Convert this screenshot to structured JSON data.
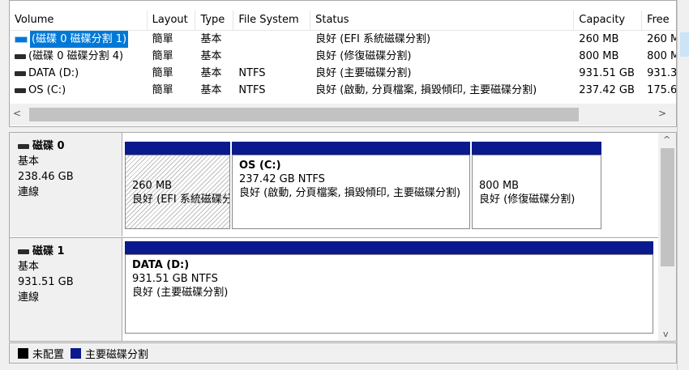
{
  "list": {
    "columns": [
      "Volume",
      "Layout",
      "Type",
      "File System",
      "Status",
      "Capacity",
      "Free"
    ],
    "rows": [
      {
        "volume": "(磁碟 0 磁碟分割 1)",
        "layout": "簡單",
        "type": "基本",
        "fs": "",
        "status": "良好 (EFI 系統磁碟分割)",
        "capacity": "260 MB",
        "free": "260 M",
        "selected": true
      },
      {
        "volume": "(磁碟 0 磁碟分割 4)",
        "layout": "簡單",
        "type": "基本",
        "fs": "",
        "status": "良好 (修復磁碟分割)",
        "capacity": "800 MB",
        "free": "800 M",
        "selected": false
      },
      {
        "volume": "DATA (D:)",
        "layout": "簡單",
        "type": "基本",
        "fs": "NTFS",
        "status": "良好 (主要磁碟分割)",
        "capacity": "931.51 GB",
        "free": "931.3",
        "selected": false
      },
      {
        "volume": "OS (C:)",
        "layout": "簡單",
        "type": "基本",
        "fs": "NTFS",
        "status": "良好 (啟動, 分頁檔案, 損毀傾印, 主要磁碟分割)",
        "capacity": "237.42 GB",
        "free": "175.6",
        "selected": false
      }
    ],
    "scroll_left": "<",
    "scroll_right": ">"
  },
  "disks": [
    {
      "name": "磁碟 0",
      "type": "基本",
      "size": "238.46 GB",
      "state": "連線",
      "partitions": [
        {
          "title": "",
          "size": "260 MB",
          "status": "良好 (EFI 系統磁碟分割)"
        },
        {
          "title": "OS (C:)",
          "size": "237.42 GB NTFS",
          "status": "良好 (啟動, 分頁檔案, 損毀傾印, 主要磁碟分割)"
        },
        {
          "title": "",
          "size": "800 MB",
          "status": "良好 (修復磁碟分割)"
        }
      ]
    },
    {
      "name": "磁碟 1",
      "type": "基本",
      "size": "931.51 GB",
      "state": "連線",
      "partitions": [
        {
          "title": "DATA  (D:)",
          "size": "931.51 GB NTFS",
          "status": "良好 (主要磁碟分割)"
        }
      ]
    }
  ],
  "scroll_up": "^",
  "scroll_down": "v",
  "legend": {
    "unallocated": "未配置",
    "primary": "主要磁碟分割",
    "unallocated_color": "#000000",
    "primary_color": "#0a1a8e"
  },
  "colors": {
    "selection": "#0078d7",
    "partition_bar": "#0a1a8e"
  }
}
